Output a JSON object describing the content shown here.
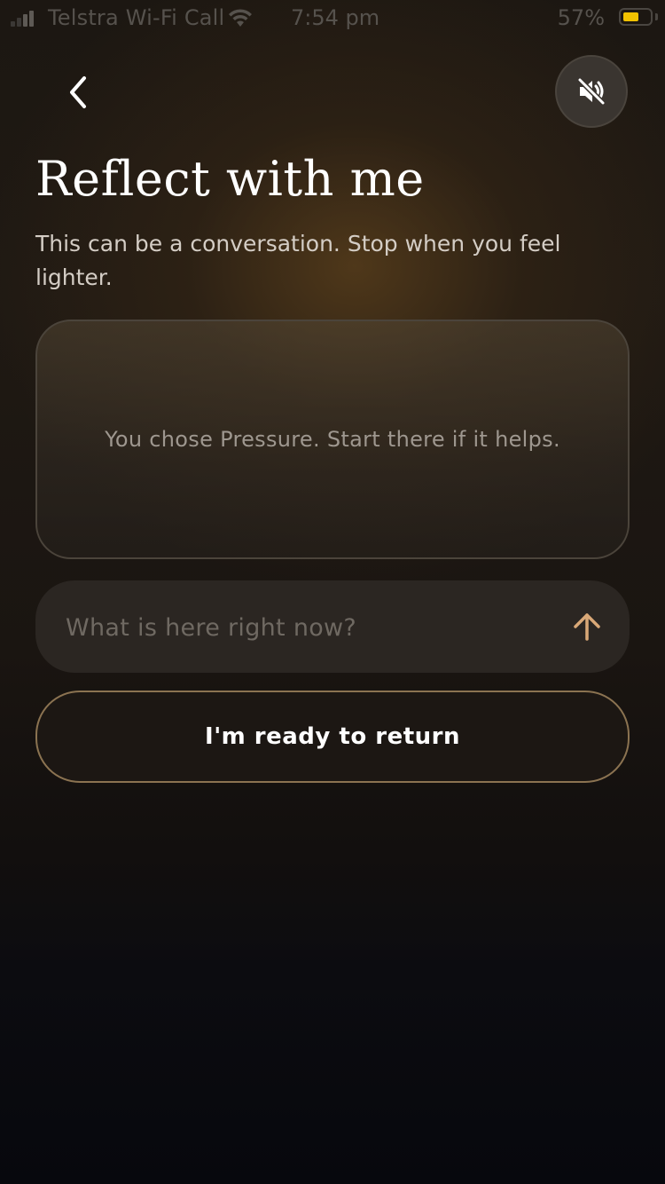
{
  "status_bar": {
    "carrier": "Telstra Wi-Fi Call",
    "time": "7:54 pm",
    "battery_percent": "57%",
    "battery_color": "#f2c200",
    "icons": [
      "signal-icon",
      "wifi-icon",
      "battery-icon"
    ]
  },
  "nav": {
    "back_icon": "chevron-left-icon",
    "mute_icon": "speaker-muted-icon"
  },
  "header": {
    "title": "Reflect with me",
    "subtitle": "This can be a conversation. Stop when you feel lighter."
  },
  "prompt_card": {
    "text": "You chose Pressure. Start there if it helps."
  },
  "composer": {
    "value": "",
    "placeholder": "What is here right now?",
    "send_icon": "arrow-up-icon",
    "accent_color": "#d9a877"
  },
  "actions": {
    "return_label": "I'm ready to return",
    "border_color": "#8b7351"
  }
}
